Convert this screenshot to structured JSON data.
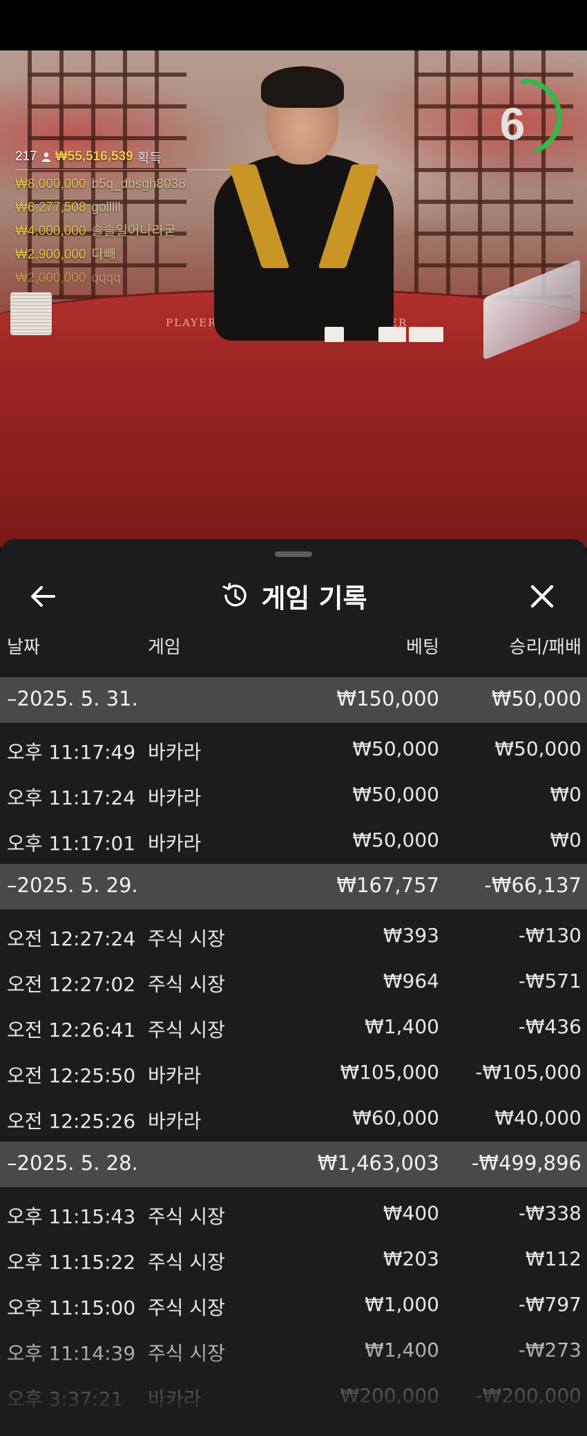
{
  "live": {
    "timer": "6",
    "table_labels": {
      "player": "PLAYER",
      "banker": "BANKER"
    },
    "winners_summary": {
      "count": "217",
      "total": "₩55,516,539",
      "suffix": "획득"
    },
    "winners": [
      {
        "amount": "₩8,000,000",
        "user": "b5q_dbsgh8038"
      },
      {
        "amount": "₩6,277,508",
        "user": "golllll"
      },
      {
        "amount": "₩4,000,000",
        "user": "솔솔일어나라굳"
      },
      {
        "amount": "₩2,900,000",
        "user": "다빼"
      },
      {
        "amount": "₩2,000,000",
        "user": "qqqq"
      }
    ],
    "colors": {
      "timer_ring": "#2dbb4a",
      "winner_amount": "#e6c64a"
    }
  },
  "panel": {
    "title": "게임 기록",
    "icons": {
      "back": "back-arrow-icon",
      "history": "history-icon",
      "close": "close-icon"
    },
    "columns": {
      "date": "날짜",
      "game": "게임",
      "bet": "베팅",
      "result": "승리/패배"
    },
    "groups": [
      {
        "date": "–2025. 5. 31.",
        "bet": "₩150,000",
        "result": "₩50,000",
        "rows": [
          {
            "time": "오후 11:17:49",
            "game": "바카라",
            "bet": "₩50,000",
            "result": "₩50,000"
          },
          {
            "time": "오후 11:17:24",
            "game": "바카라",
            "bet": "₩50,000",
            "result": "₩0"
          },
          {
            "time": "오후 11:17:01",
            "game": "바카라",
            "bet": "₩50,000",
            "result": "₩0"
          }
        ]
      },
      {
        "date": "–2025. 5. 29.",
        "bet": "₩167,757",
        "result": "-₩66,137",
        "rows": [
          {
            "time": "오전 12:27:24",
            "game": "주식 시장",
            "bet": "₩393",
            "result": "-₩130"
          },
          {
            "time": "오전 12:27:02",
            "game": "주식 시장",
            "bet": "₩964",
            "result": "-₩571"
          },
          {
            "time": "오전 12:26:41",
            "game": "주식 시장",
            "bet": "₩1,400",
            "result": "-₩436"
          },
          {
            "time": "오전 12:25:50",
            "game": "바카라",
            "bet": "₩105,000",
            "result": "-₩105,000"
          },
          {
            "time": "오전 12:25:26",
            "game": "바카라",
            "bet": "₩60,000",
            "result": "₩40,000"
          }
        ]
      },
      {
        "date": "–2025. 5. 28.",
        "bet": "₩1,463,003",
        "result": "-₩499,896",
        "rows": [
          {
            "time": "오후 11:15:43",
            "game": "주식 시장",
            "bet": "₩400",
            "result": "-₩338"
          },
          {
            "time": "오후 11:15:22",
            "game": "주식 시장",
            "bet": "₩203",
            "result": "₩112"
          },
          {
            "time": "오후 11:15:00",
            "game": "주식 시장",
            "bet": "₩1,000",
            "result": "-₩797"
          },
          {
            "time": "오후 11:14:39",
            "game": "주식 시장",
            "bet": "₩1,400",
            "result": "-₩273"
          },
          {
            "time": "오후 3:37:21",
            "game": "바카라",
            "bet": "₩200,000",
            "result": "-₩200,000"
          }
        ]
      }
    ]
  }
}
